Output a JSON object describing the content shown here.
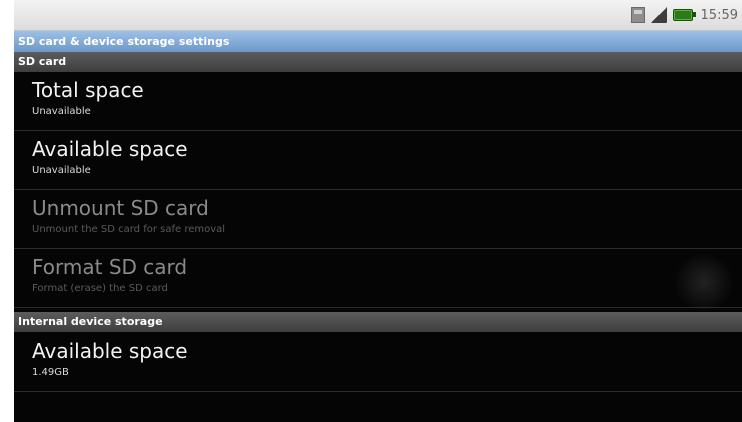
{
  "status_bar": {
    "time": "15:59",
    "icons": [
      "sd-card-icon",
      "signal-icon",
      "battery-icon"
    ]
  },
  "title_bar": {
    "title": "SD card & device storage settings"
  },
  "sd_card_section": {
    "header": "SD card",
    "items": [
      {
        "title": "Total space",
        "summary": "Unavailable",
        "enabled": true
      },
      {
        "title": "Available space",
        "summary": "Unavailable",
        "enabled": true
      },
      {
        "title": "Unmount SD card",
        "summary": "Unmount the SD card for safe removal",
        "enabled": false
      },
      {
        "title": "Format SD card",
        "summary": "Format (erase) the SD card",
        "enabled": false
      }
    ]
  },
  "internal_section": {
    "header": "Internal device storage",
    "items": [
      {
        "title": "Available space",
        "summary": "1.49GB",
        "enabled": true
      }
    ]
  },
  "colors": {
    "title_bar": "#7ea6d4",
    "background": "#050505",
    "section_header": "#4a4a4a"
  }
}
